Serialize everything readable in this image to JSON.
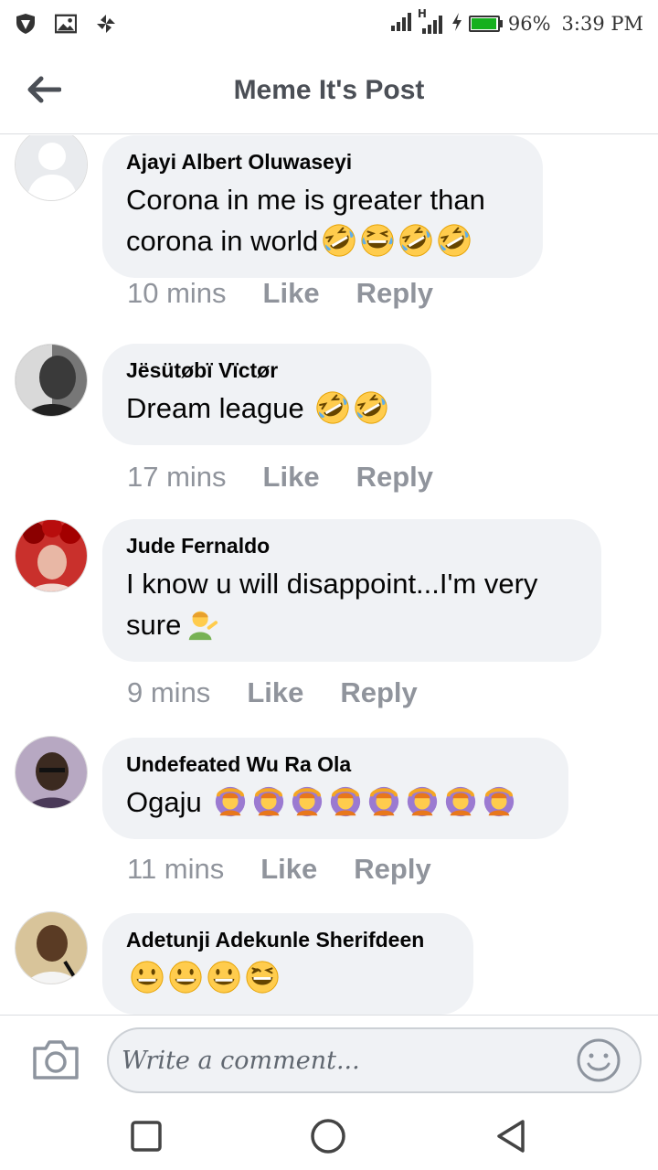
{
  "status_bar": {
    "icons_left": [
      "shield-icon",
      "image-icon",
      "pinwheel-icon"
    ],
    "network_label": "H",
    "battery_percent": "96%",
    "battery_level": 0.96,
    "time": "3:39 PM"
  },
  "header": {
    "back_icon": "arrow-left-icon",
    "title": "Meme It's Post"
  },
  "comments": [
    {
      "author": "Ajayi Albert Oluwaseyi",
      "text": "Corona in me is greater than corona in world",
      "emojis": [
        "rolling-laughing",
        "joy",
        "rolling-laughing",
        "rolling-laughing"
      ],
      "time": "10 mins",
      "like": "Like",
      "reply": "Reply"
    },
    {
      "author": "Jësütøbï Vïctør",
      "text": "Dream league ",
      "emojis": [
        "rolling-laughing",
        "rolling-laughing"
      ],
      "time": "17 mins",
      "like": "Like",
      "reply": "Reply"
    },
    {
      "author": "Jude Fernaldo",
      "text": "I know u will disappoint...I'm very sure",
      "emojis": [
        "person-tipping-hand"
      ],
      "time": "9 mins",
      "like": "Like",
      "reply": "Reply"
    },
    {
      "author": "Undefeated Wu Ra Ola",
      "text": "Ogaju ",
      "emojis": [
        "person-gesturing-ok",
        "person-gesturing-ok",
        "person-gesturing-ok",
        "person-gesturing-ok",
        "person-gesturing-ok",
        "person-gesturing-ok",
        "person-gesturing-ok",
        "person-gesturing-ok"
      ],
      "time": "11 mins",
      "like": "Like",
      "reply": "Reply"
    },
    {
      "author": "Adetunji Adekunle Sherifdeen",
      "text": "",
      "emojis": [
        "grinning",
        "grinning",
        "grinning",
        "smile"
      ],
      "time": "",
      "like": "",
      "reply": ""
    }
  ],
  "composer": {
    "camera_icon": "camera-icon",
    "placeholder": "Write a comment...",
    "emoji_icon": "smiley-icon"
  },
  "nav": {
    "recents_icon": "square-icon",
    "home_icon": "circle-icon",
    "back_icon": "triangle-back-icon"
  }
}
